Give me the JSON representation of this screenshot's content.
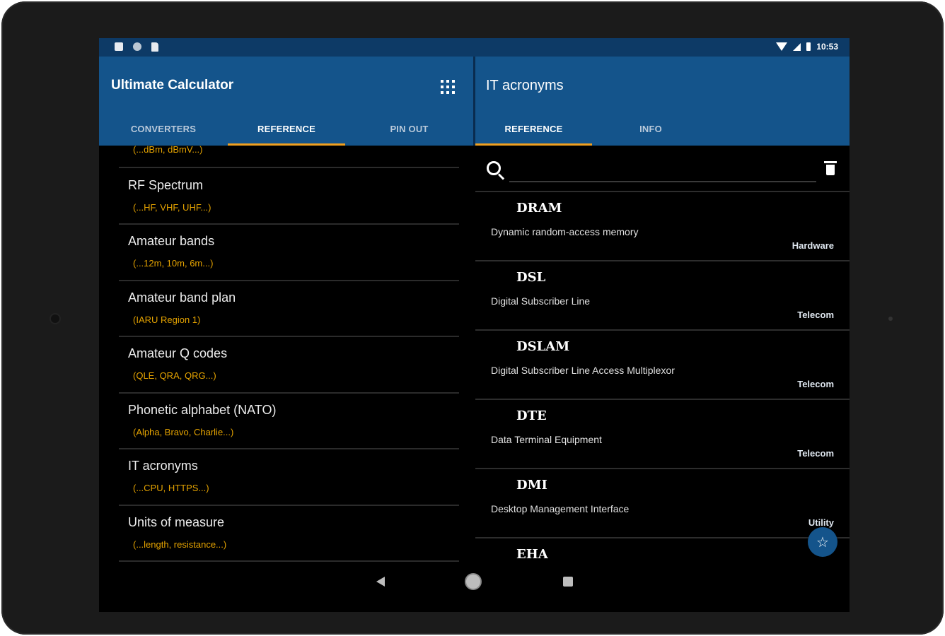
{
  "status_bar": {
    "time": "10:53"
  },
  "left_pane": {
    "title": "Ultimate Calculator",
    "tabs": [
      {
        "label": "CONVERTERS",
        "active": false
      },
      {
        "label": "REFERENCE",
        "active": true
      },
      {
        "label": "PIN OUT",
        "active": false
      }
    ],
    "partial_item_sub": "(...dBm, dBmV...)",
    "items": [
      {
        "name": "RF Spectrum",
        "sub": "(...HF, VHF, UHF...)"
      },
      {
        "name": "Amateur bands",
        "sub": "(...12m, 10m, 6m...)"
      },
      {
        "name": "Amateur band plan",
        "sub": "(IARU Region 1)"
      },
      {
        "name": "Amateur Q codes",
        "sub": "(QLE, QRA, QRG...)"
      },
      {
        "name": "Phonetic alphabet (NATO)",
        "sub": "(Alpha, Bravo, Charlie...)"
      },
      {
        "name": "IT acronyms",
        "sub": "(...CPU, HTTPS...)"
      },
      {
        "name": "Units of measure",
        "sub": "(...length, resistance...)"
      }
    ]
  },
  "right_pane": {
    "title": "IT acronyms",
    "tabs": [
      {
        "label": "REFERENCE",
        "active": true
      },
      {
        "label": "INFO",
        "active": false
      }
    ],
    "search": {
      "value": "",
      "placeholder": ""
    },
    "acronyms": [
      {
        "term": "DRAM",
        "desc": "Dynamic random-access memory",
        "category": "Hardware"
      },
      {
        "term": "DSL",
        "desc": "Digital Subscriber Line",
        "category": "Telecom"
      },
      {
        "term": "DSLAM",
        "desc": "Digital Subscriber Line Access Multiplexor",
        "category": "Telecom"
      },
      {
        "term": "DTE",
        "desc": "Data Terminal Equipment",
        "category": "Telecom"
      },
      {
        "term": "DMI",
        "desc": "Desktop Management Interface",
        "category": "Utility"
      },
      {
        "term": "EHA",
        "desc": "",
        "category": ""
      }
    ]
  },
  "colors": {
    "appbar": "#14548b",
    "statusbar": "#0d3a66",
    "accent": "#f0a020",
    "subtitle": "#e5a300"
  }
}
